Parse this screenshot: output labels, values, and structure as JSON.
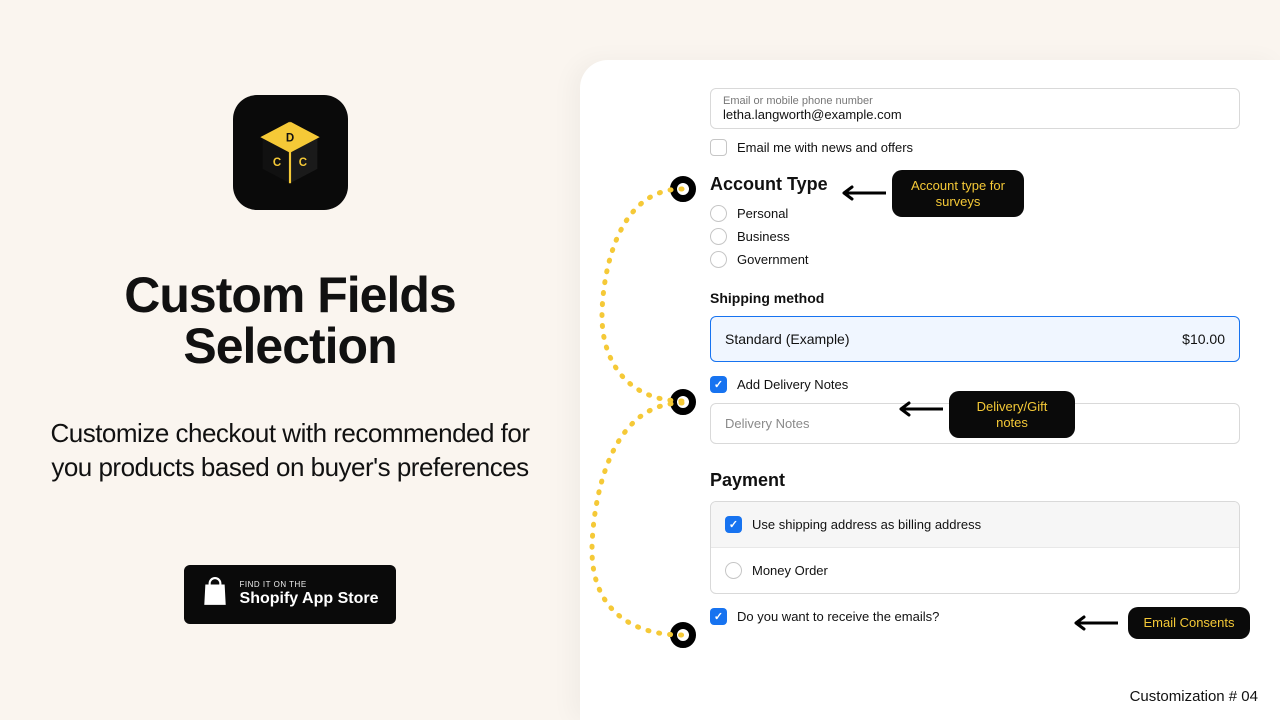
{
  "left": {
    "title_line1": "Custom Fields",
    "title_line2": "Selection",
    "subtitle": "Customize checkout with recommended for you products based on buyer's preferences",
    "store_badge_small": "FIND IT ON THE",
    "store_badge_big": "Shopify App Store"
  },
  "checkout": {
    "email_label": "Email or mobile phone number",
    "email_value": "letha.langworth@example.com",
    "news_offers": "Email me with news and offers",
    "account_type_heading": "Account Type",
    "account_options": {
      "a": "Personal",
      "b": "Business",
      "c": "Government"
    },
    "shipping_heading": "Shipping method",
    "shipping_option": "Standard (Example)",
    "shipping_price": "$10.00",
    "add_delivery_notes": "Add Delivery Notes",
    "delivery_notes_placeholder": "Delivery Notes",
    "payment_heading": "Payment",
    "payment_billing": "Use shipping address as billing address",
    "payment_money_order": "Money Order",
    "email_consent": "Do you want to receive the emails?"
  },
  "callouts": {
    "account": "Account type for surveys",
    "delivery": "Delivery/Gift notes",
    "email": "Email Consents"
  },
  "footer": "Customization # 04"
}
